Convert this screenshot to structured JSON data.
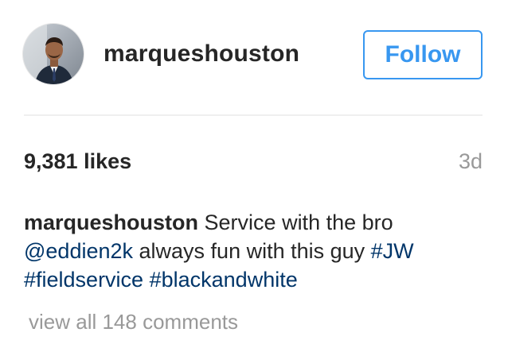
{
  "post": {
    "username": "marqueshouston",
    "follow_label": "Follow",
    "likes": "9,381 likes",
    "time": "3d",
    "caption": {
      "author": "marqueshouston",
      "text_1": " Service with the bro",
      "mention": "@eddien2k",
      "text_2": " always fun with this guy ",
      "hashtag_1": "#JW",
      "hashtag_2": "#fieldservice",
      "hashtag_3": "#blackandwhite"
    },
    "comments_link": "view all 148 comments"
  },
  "colors": {
    "accent": "#3897f0",
    "link": "#003569",
    "muted": "#999999",
    "text": "#262626"
  },
  "icons": {
    "avatar": "profile-photo"
  }
}
